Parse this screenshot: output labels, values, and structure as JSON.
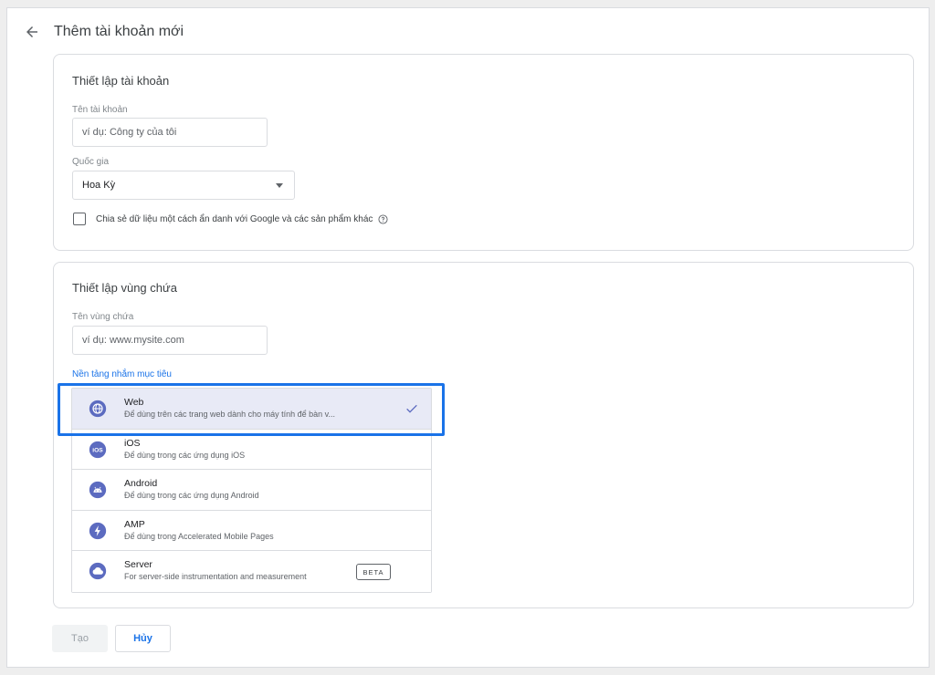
{
  "header": {
    "title": "Thêm tài khoản mới",
    "back_icon": "arrow-left"
  },
  "account_setup": {
    "title": "Thiết lập tài khoản",
    "name_label": "Tên tài khoản",
    "name_placeholder": "ví dụ: Công ty của tôi",
    "name_value": "",
    "country_label": "Quốc gia",
    "country_value": "Hoa Kỳ",
    "share_data_label": "Chia sẻ dữ liệu một cách ẩn danh với Google và các sản phẩm khác",
    "share_data_checked": false
  },
  "container_setup": {
    "title": "Thiết lập vùng chứa",
    "name_label": "Tên vùng chứa",
    "name_placeholder": "ví dụ: www.mysite.com",
    "name_value": "",
    "platform_label": "Nền tảng nhắm mục tiêu",
    "platforms": [
      {
        "name": "Web",
        "desc": "Để dùng trên các trang web dành cho máy tính để bàn v...",
        "icon": "globe-icon",
        "selected": true
      },
      {
        "name": "iOS",
        "desc": "Để dùng trong các ứng dụng iOS",
        "icon": "ios-icon",
        "selected": false
      },
      {
        "name": "Android",
        "desc": "Để dùng trong các ứng dụng Android",
        "icon": "android-icon",
        "selected": false
      },
      {
        "name": "AMP",
        "desc": "Để dùng trong Accelerated Mobile Pages",
        "icon": "amp-bolt-icon",
        "selected": false
      },
      {
        "name": "Server",
        "desc": "For server-side instrumentation and measurement",
        "icon": "cloud-icon",
        "selected": false,
        "badge": "BETA"
      }
    ]
  },
  "buttons": {
    "create_label": "Tạo",
    "cancel_label": "Hủy"
  },
  "colors": {
    "accent": "#1a73e8",
    "platform_icon": "#5c6bc0",
    "selected_bg": "#e8eaf6",
    "highlight_border": "#1a73e8"
  }
}
